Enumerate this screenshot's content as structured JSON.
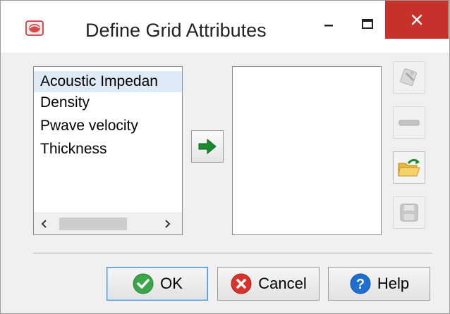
{
  "window": {
    "title": "Define Grid Attributes",
    "icons": {
      "app": "app-emblem-icon",
      "minimize": "minimize-icon",
      "maximize": "maximize-icon",
      "close": "close-icon"
    },
    "close_color": "#c7312b"
  },
  "source_list": {
    "items": [
      {
        "label": "Acoustic Impedan",
        "selected": true
      },
      {
        "label": "Density",
        "selected": false
      },
      {
        "label": "Pwave velocity",
        "selected": false
      },
      {
        "label": "Thickness",
        "selected": false
      }
    ],
    "scroll_left_glyph": "‹",
    "scroll_right_glyph": "›"
  },
  "move_button": {
    "icon": "arrow-right-icon",
    "color": "#1a8a2a"
  },
  "selected_list": {
    "items": []
  },
  "side_buttons": [
    {
      "icon": "edit-icon",
      "enabled": false
    },
    {
      "icon": "remove-icon",
      "enabled": false
    },
    {
      "icon": "open-folder-icon",
      "enabled": true
    },
    {
      "icon": "save-icon",
      "enabled": false
    }
  ],
  "buttons": {
    "ok": {
      "label": "OK",
      "icon": "check-icon",
      "color": "#3aa64a"
    },
    "cancel": {
      "label": "Cancel",
      "icon": "cancel-x-icon",
      "color": "#d9342b"
    },
    "help": {
      "label": "Help",
      "icon": "help-question-icon",
      "color": "#1f6fd0"
    }
  }
}
